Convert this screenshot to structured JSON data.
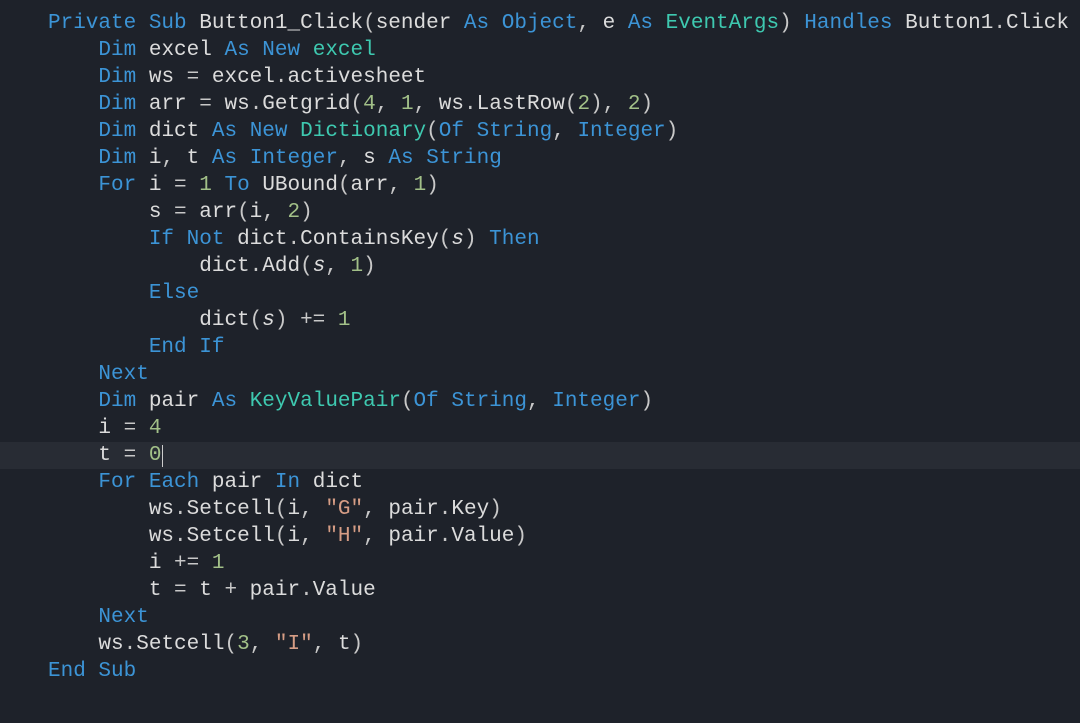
{
  "code": {
    "lines": [
      [
        {
          "cls": "kw",
          "t": "Private"
        },
        {
          "cls": "punc",
          "t": " "
        },
        {
          "cls": "kw",
          "t": "Sub"
        },
        {
          "cls": "punc",
          "t": " "
        },
        {
          "cls": "ident",
          "t": "Button1_Click"
        },
        {
          "cls": "punc",
          "t": "("
        },
        {
          "cls": "ident",
          "t": "sender"
        },
        {
          "cls": "punc",
          "t": " "
        },
        {
          "cls": "kw",
          "t": "As"
        },
        {
          "cls": "punc",
          "t": " "
        },
        {
          "cls": "kw",
          "t": "Object"
        },
        {
          "cls": "punc",
          "t": ", "
        },
        {
          "cls": "ident",
          "t": "e"
        },
        {
          "cls": "punc",
          "t": " "
        },
        {
          "cls": "kw",
          "t": "As"
        },
        {
          "cls": "punc",
          "t": " "
        },
        {
          "cls": "type",
          "t": "EventArgs"
        },
        {
          "cls": "punc",
          "t": ") "
        },
        {
          "cls": "kw",
          "t": "Handles"
        },
        {
          "cls": "punc",
          "t": " "
        },
        {
          "cls": "ident",
          "t": "Button1"
        },
        {
          "cls": "punc",
          "t": "."
        },
        {
          "cls": "ident",
          "t": "Click"
        }
      ],
      [
        {
          "cls": "punc",
          "t": "    "
        },
        {
          "cls": "kw",
          "t": "Dim"
        },
        {
          "cls": "punc",
          "t": " "
        },
        {
          "cls": "ident",
          "t": "excel"
        },
        {
          "cls": "punc",
          "t": " "
        },
        {
          "cls": "kw",
          "t": "As"
        },
        {
          "cls": "punc",
          "t": " "
        },
        {
          "cls": "kw",
          "t": "New"
        },
        {
          "cls": "punc",
          "t": " "
        },
        {
          "cls": "type",
          "t": "excel"
        }
      ],
      [
        {
          "cls": "punc",
          "t": "    "
        },
        {
          "cls": "kw",
          "t": "Dim"
        },
        {
          "cls": "punc",
          "t": " "
        },
        {
          "cls": "ident",
          "t": "ws"
        },
        {
          "cls": "punc",
          "t": " = "
        },
        {
          "cls": "ident",
          "t": "excel"
        },
        {
          "cls": "punc",
          "t": "."
        },
        {
          "cls": "ident",
          "t": "activesheet"
        }
      ],
      [
        {
          "cls": "punc",
          "t": "    "
        },
        {
          "cls": "kw",
          "t": "Dim"
        },
        {
          "cls": "punc",
          "t": " "
        },
        {
          "cls": "ident",
          "t": "arr"
        },
        {
          "cls": "punc",
          "t": " = "
        },
        {
          "cls": "ident",
          "t": "ws"
        },
        {
          "cls": "punc",
          "t": "."
        },
        {
          "cls": "ident",
          "t": "Getgrid"
        },
        {
          "cls": "punc",
          "t": "("
        },
        {
          "cls": "num",
          "t": "4"
        },
        {
          "cls": "punc",
          "t": ", "
        },
        {
          "cls": "num",
          "t": "1"
        },
        {
          "cls": "punc",
          "t": ", "
        },
        {
          "cls": "ident",
          "t": "ws"
        },
        {
          "cls": "punc",
          "t": "."
        },
        {
          "cls": "ident",
          "t": "LastRow"
        },
        {
          "cls": "punc",
          "t": "("
        },
        {
          "cls": "num",
          "t": "2"
        },
        {
          "cls": "punc",
          "t": "), "
        },
        {
          "cls": "num",
          "t": "2"
        },
        {
          "cls": "punc",
          "t": ")"
        }
      ],
      [
        {
          "cls": "punc",
          "t": "    "
        },
        {
          "cls": "kw",
          "t": "Dim"
        },
        {
          "cls": "punc",
          "t": " "
        },
        {
          "cls": "ident",
          "t": "dict"
        },
        {
          "cls": "punc",
          "t": " "
        },
        {
          "cls": "kw",
          "t": "As"
        },
        {
          "cls": "punc",
          "t": " "
        },
        {
          "cls": "kw",
          "t": "New"
        },
        {
          "cls": "punc",
          "t": " "
        },
        {
          "cls": "type",
          "t": "Dictionary"
        },
        {
          "cls": "punc",
          "t": "("
        },
        {
          "cls": "kw",
          "t": "Of"
        },
        {
          "cls": "punc",
          "t": " "
        },
        {
          "cls": "kw",
          "t": "String"
        },
        {
          "cls": "punc",
          "t": ", "
        },
        {
          "cls": "kw",
          "t": "Integer"
        },
        {
          "cls": "punc",
          "t": ")"
        }
      ],
      [
        {
          "cls": "punc",
          "t": "    "
        },
        {
          "cls": "kw",
          "t": "Dim"
        },
        {
          "cls": "punc",
          "t": " "
        },
        {
          "cls": "ident",
          "t": "i"
        },
        {
          "cls": "punc",
          "t": ", "
        },
        {
          "cls": "ident",
          "t": "t"
        },
        {
          "cls": "punc",
          "t": " "
        },
        {
          "cls": "kw",
          "t": "As"
        },
        {
          "cls": "punc",
          "t": " "
        },
        {
          "cls": "kw",
          "t": "Integer"
        },
        {
          "cls": "punc",
          "t": ", "
        },
        {
          "cls": "ident",
          "t": "s"
        },
        {
          "cls": "punc",
          "t": " "
        },
        {
          "cls": "kw",
          "t": "As"
        },
        {
          "cls": "punc",
          "t": " "
        },
        {
          "cls": "kw",
          "t": "String"
        }
      ],
      [
        {
          "cls": "punc",
          "t": "    "
        },
        {
          "cls": "kw",
          "t": "For"
        },
        {
          "cls": "punc",
          "t": " "
        },
        {
          "cls": "ident",
          "t": "i"
        },
        {
          "cls": "punc",
          "t": " = "
        },
        {
          "cls": "num",
          "t": "1"
        },
        {
          "cls": "punc",
          "t": " "
        },
        {
          "cls": "kw",
          "t": "To"
        },
        {
          "cls": "punc",
          "t": " "
        },
        {
          "cls": "ident",
          "t": "UBound"
        },
        {
          "cls": "punc",
          "t": "("
        },
        {
          "cls": "ident",
          "t": "arr"
        },
        {
          "cls": "punc",
          "t": ", "
        },
        {
          "cls": "num",
          "t": "1"
        },
        {
          "cls": "punc",
          "t": ")"
        }
      ],
      [
        {
          "cls": "punc",
          "t": "        "
        },
        {
          "cls": "ident",
          "t": "s"
        },
        {
          "cls": "punc",
          "t": " = "
        },
        {
          "cls": "ident",
          "t": "arr"
        },
        {
          "cls": "punc",
          "t": "("
        },
        {
          "cls": "ident",
          "t": "i"
        },
        {
          "cls": "punc",
          "t": ", "
        },
        {
          "cls": "num",
          "t": "2"
        },
        {
          "cls": "punc",
          "t": ")"
        }
      ],
      [
        {
          "cls": "punc",
          "t": "        "
        },
        {
          "cls": "kw",
          "t": "If"
        },
        {
          "cls": "punc",
          "t": " "
        },
        {
          "cls": "kw",
          "t": "Not"
        },
        {
          "cls": "punc",
          "t": " "
        },
        {
          "cls": "ident",
          "t": "dict"
        },
        {
          "cls": "punc",
          "t": "."
        },
        {
          "cls": "ident",
          "t": "ContainsKey"
        },
        {
          "cls": "punc",
          "t": "("
        },
        {
          "cls": "ident ital",
          "t": "s"
        },
        {
          "cls": "punc",
          "t": ") "
        },
        {
          "cls": "kw",
          "t": "Then"
        }
      ],
      [
        {
          "cls": "punc",
          "t": "            "
        },
        {
          "cls": "ident",
          "t": "dict"
        },
        {
          "cls": "punc",
          "t": "."
        },
        {
          "cls": "ident",
          "t": "Add"
        },
        {
          "cls": "punc",
          "t": "("
        },
        {
          "cls": "ident ital",
          "t": "s"
        },
        {
          "cls": "punc",
          "t": ", "
        },
        {
          "cls": "num",
          "t": "1"
        },
        {
          "cls": "punc",
          "t": ")"
        }
      ],
      [
        {
          "cls": "punc",
          "t": "        "
        },
        {
          "cls": "kw",
          "t": "Else"
        }
      ],
      [
        {
          "cls": "punc",
          "t": "            "
        },
        {
          "cls": "ident",
          "t": "dict"
        },
        {
          "cls": "punc",
          "t": "("
        },
        {
          "cls": "ident ital",
          "t": "s"
        },
        {
          "cls": "punc",
          "t": ") += "
        },
        {
          "cls": "num",
          "t": "1"
        }
      ],
      [
        {
          "cls": "punc",
          "t": "        "
        },
        {
          "cls": "kw",
          "t": "End"
        },
        {
          "cls": "punc",
          "t": " "
        },
        {
          "cls": "kw",
          "t": "If"
        }
      ],
      [
        {
          "cls": "punc",
          "t": "    "
        },
        {
          "cls": "kw",
          "t": "Next"
        }
      ],
      [
        {
          "cls": "punc",
          "t": "    "
        },
        {
          "cls": "kw",
          "t": "Dim"
        },
        {
          "cls": "punc",
          "t": " "
        },
        {
          "cls": "ident",
          "t": "pair"
        },
        {
          "cls": "punc",
          "t": " "
        },
        {
          "cls": "kw",
          "t": "As"
        },
        {
          "cls": "punc",
          "t": " "
        },
        {
          "cls": "type",
          "t": "KeyValuePair"
        },
        {
          "cls": "punc",
          "t": "("
        },
        {
          "cls": "kw",
          "t": "Of"
        },
        {
          "cls": "punc",
          "t": " "
        },
        {
          "cls": "kw",
          "t": "String"
        },
        {
          "cls": "punc",
          "t": ", "
        },
        {
          "cls": "kw",
          "t": "Integer"
        },
        {
          "cls": "punc",
          "t": ")"
        }
      ],
      [
        {
          "cls": "punc",
          "t": "    "
        },
        {
          "cls": "ident",
          "t": "i"
        },
        {
          "cls": "punc",
          "t": " = "
        },
        {
          "cls": "num",
          "t": "4"
        }
      ],
      [
        {
          "cls": "punc",
          "t": "    "
        },
        {
          "cls": "ident",
          "t": "t"
        },
        {
          "cls": "punc",
          "t": " = "
        },
        {
          "cls": "num",
          "t": "0"
        }
      ],
      [
        {
          "cls": "punc",
          "t": "    "
        },
        {
          "cls": "kw",
          "t": "For"
        },
        {
          "cls": "punc",
          "t": " "
        },
        {
          "cls": "kw",
          "t": "Each"
        },
        {
          "cls": "punc",
          "t": " "
        },
        {
          "cls": "ident",
          "t": "pair"
        },
        {
          "cls": "punc",
          "t": " "
        },
        {
          "cls": "kw",
          "t": "In"
        },
        {
          "cls": "punc",
          "t": " "
        },
        {
          "cls": "ident",
          "t": "dict"
        }
      ],
      [
        {
          "cls": "punc",
          "t": "        "
        },
        {
          "cls": "ident",
          "t": "ws"
        },
        {
          "cls": "punc",
          "t": "."
        },
        {
          "cls": "ident",
          "t": "Setcell"
        },
        {
          "cls": "punc",
          "t": "("
        },
        {
          "cls": "ident",
          "t": "i"
        },
        {
          "cls": "punc",
          "t": ", "
        },
        {
          "cls": "str",
          "t": "\"G\""
        },
        {
          "cls": "punc",
          "t": ", "
        },
        {
          "cls": "ident",
          "t": "pair"
        },
        {
          "cls": "punc",
          "t": "."
        },
        {
          "cls": "ident",
          "t": "Key"
        },
        {
          "cls": "punc",
          "t": ")"
        }
      ],
      [
        {
          "cls": "punc",
          "t": "        "
        },
        {
          "cls": "ident",
          "t": "ws"
        },
        {
          "cls": "punc",
          "t": "."
        },
        {
          "cls": "ident",
          "t": "Setcell"
        },
        {
          "cls": "punc",
          "t": "("
        },
        {
          "cls": "ident",
          "t": "i"
        },
        {
          "cls": "punc",
          "t": ", "
        },
        {
          "cls": "str",
          "t": "\"H\""
        },
        {
          "cls": "punc",
          "t": ", "
        },
        {
          "cls": "ident",
          "t": "pair"
        },
        {
          "cls": "punc",
          "t": "."
        },
        {
          "cls": "ident",
          "t": "Value"
        },
        {
          "cls": "punc",
          "t": ")"
        }
      ],
      [
        {
          "cls": "punc",
          "t": "        "
        },
        {
          "cls": "ident",
          "t": "i"
        },
        {
          "cls": "punc",
          "t": " += "
        },
        {
          "cls": "num",
          "t": "1"
        }
      ],
      [
        {
          "cls": "punc",
          "t": "        "
        },
        {
          "cls": "ident",
          "t": "t"
        },
        {
          "cls": "punc",
          "t": " = "
        },
        {
          "cls": "ident",
          "t": "t"
        },
        {
          "cls": "punc",
          "t": " + "
        },
        {
          "cls": "ident",
          "t": "pair"
        },
        {
          "cls": "punc",
          "t": "."
        },
        {
          "cls": "ident",
          "t": "Value"
        }
      ],
      [
        {
          "cls": "punc",
          "t": "    "
        },
        {
          "cls": "kw",
          "t": "Next"
        }
      ],
      [
        {
          "cls": "punc",
          "t": "    "
        },
        {
          "cls": "ident",
          "t": "ws"
        },
        {
          "cls": "punc",
          "t": "."
        },
        {
          "cls": "ident",
          "t": "Setcell"
        },
        {
          "cls": "punc",
          "t": "("
        },
        {
          "cls": "num",
          "t": "3"
        },
        {
          "cls": "punc",
          "t": ", "
        },
        {
          "cls": "str",
          "t": "\"I\""
        },
        {
          "cls": "punc",
          "t": ", "
        },
        {
          "cls": "ident",
          "t": "t"
        },
        {
          "cls": "punc",
          "t": ")"
        }
      ],
      [
        {
          "cls": "kw",
          "t": "End"
        },
        {
          "cls": "punc",
          "t": " "
        },
        {
          "cls": "kw",
          "t": "Sub"
        }
      ]
    ],
    "current_line_index": 16
  }
}
